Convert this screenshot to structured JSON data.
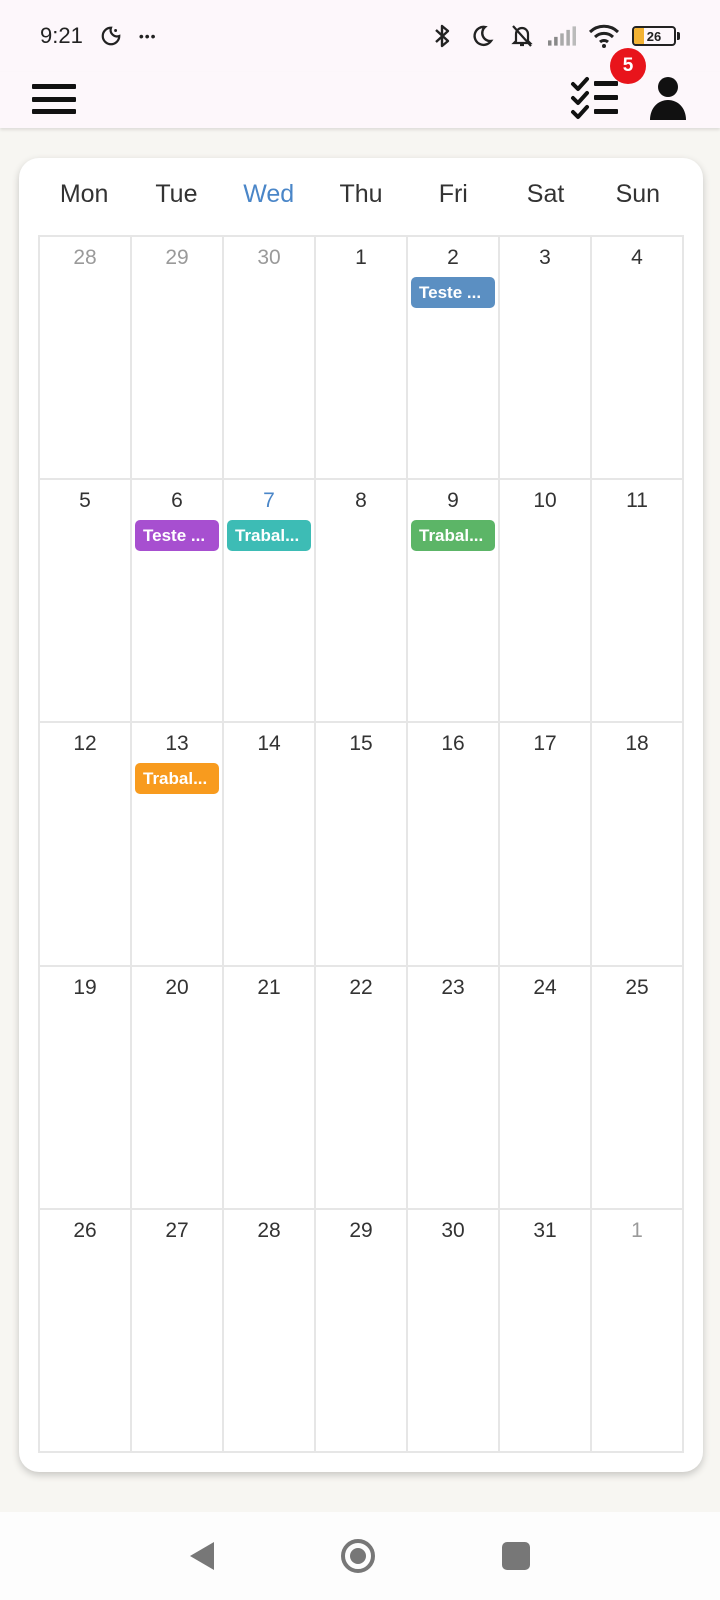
{
  "status_bar": {
    "time": "9:21",
    "more_glyph": "•••",
    "battery_level": "26",
    "icons": [
      "night-mode-icon",
      "bluetooth-icon",
      "moon-icon",
      "bell-off-icon",
      "signal-icon",
      "wifi-icon",
      "battery-icon"
    ]
  },
  "app_bar": {
    "menu_icon": "hamburger-menu-icon",
    "tasks_icon": "checklist-icon",
    "tasks_badge": "5",
    "user_icon": "user-icon",
    "badge_color": "#e8141b"
  },
  "calendar": {
    "weekdays": [
      "Mon",
      "Tue",
      "Wed",
      "Thu",
      "Fri",
      "Sat",
      "Sun"
    ],
    "today_weekday_index": 2,
    "today_color": "#4a86c8",
    "weeks": [
      [
        {
          "day": "28",
          "muted": true
        },
        {
          "day": "29",
          "muted": true
        },
        {
          "day": "30",
          "muted": true
        },
        {
          "day": "1"
        },
        {
          "day": "2",
          "events": [
            {
              "label": "Teste ...",
              "color": "#5b8fc2"
            }
          ]
        },
        {
          "day": "3"
        },
        {
          "day": "4"
        }
      ],
      [
        {
          "day": "5"
        },
        {
          "day": "6",
          "events": [
            {
              "label": "Teste ...",
              "color": "#a74fd0"
            }
          ]
        },
        {
          "day": "7",
          "today": true,
          "events": [
            {
              "label": "Trabal...",
              "color": "#3dbcb5"
            }
          ]
        },
        {
          "day": "8"
        },
        {
          "day": "9",
          "events": [
            {
              "label": "Trabal...",
              "color": "#5cb567"
            }
          ]
        },
        {
          "day": "10"
        },
        {
          "day": "11"
        }
      ],
      [
        {
          "day": "12"
        },
        {
          "day": "13",
          "events": [
            {
              "label": "Trabal...",
              "color": "#f89b1e"
            }
          ]
        },
        {
          "day": "14"
        },
        {
          "day": "15"
        },
        {
          "day": "16"
        },
        {
          "day": "17"
        },
        {
          "day": "18"
        }
      ],
      [
        {
          "day": "19"
        },
        {
          "day": "20"
        },
        {
          "day": "21"
        },
        {
          "day": "22"
        },
        {
          "day": "23"
        },
        {
          "day": "24"
        },
        {
          "day": "25"
        }
      ],
      [
        {
          "day": "26"
        },
        {
          "day": "27"
        },
        {
          "day": "28"
        },
        {
          "day": "29"
        },
        {
          "day": "30"
        },
        {
          "day": "31"
        },
        {
          "day": "1",
          "muted": true
        }
      ]
    ]
  },
  "nav_bar": {
    "icons": [
      "back-icon",
      "home-icon",
      "recents-icon"
    ]
  }
}
